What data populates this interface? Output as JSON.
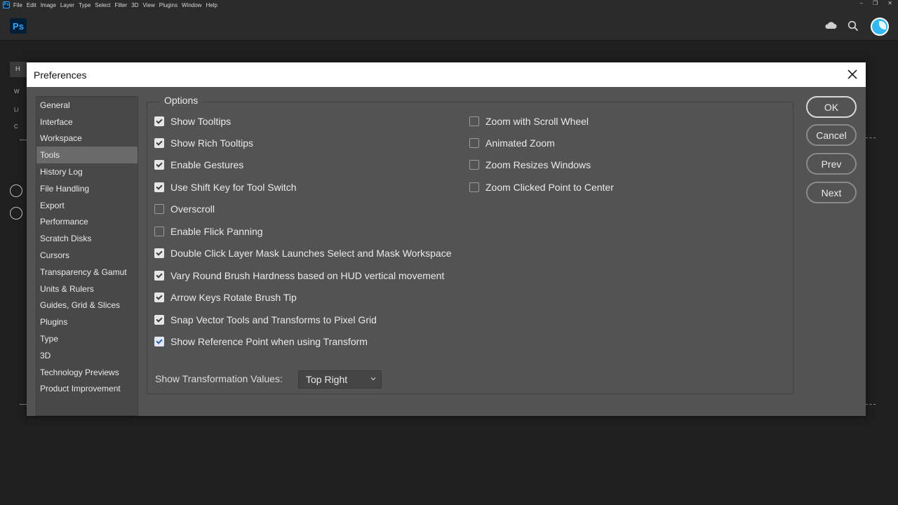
{
  "menubar": {
    "app_icon": "photoshop-icon",
    "items": [
      "File",
      "Edit",
      "Image",
      "Layer",
      "Type",
      "Select",
      "Filter",
      "3D",
      "View",
      "Plugins",
      "Window",
      "Help"
    ]
  },
  "header": {
    "logo_text": "Ps",
    "icons": [
      "cloud-icon",
      "search-icon",
      "avatar"
    ]
  },
  "background": {
    "tab_text": "H",
    "side_letters": [
      "W",
      "Li",
      "C"
    ]
  },
  "dialog": {
    "title": "Preferences",
    "sidebar": [
      {
        "label": "General",
        "active": false
      },
      {
        "label": "Interface",
        "active": false
      },
      {
        "label": "Workspace",
        "active": false
      },
      {
        "label": "Tools",
        "active": true
      },
      {
        "label": "History Log",
        "active": false
      },
      {
        "label": "File Handling",
        "active": false
      },
      {
        "label": "Export",
        "active": false
      },
      {
        "label": "Performance",
        "active": false
      },
      {
        "label": "Scratch Disks",
        "active": false
      },
      {
        "label": "Cursors",
        "active": false
      },
      {
        "label": "Transparency & Gamut",
        "active": false
      },
      {
        "label": "Units & Rulers",
        "active": false
      },
      {
        "label": "Guides, Grid & Slices",
        "active": false
      },
      {
        "label": "Plugins",
        "active": false
      },
      {
        "label": "Type",
        "active": false
      },
      {
        "label": "3D",
        "active": false
      },
      {
        "label": "Technology Previews",
        "active": false
      },
      {
        "label": "Product Improvement",
        "active": false
      }
    ],
    "options_title": "Options",
    "left_options": [
      {
        "label": "Show Tooltips",
        "checked": true
      },
      {
        "label": "Show Rich Tooltips",
        "checked": true
      },
      {
        "label": "Enable Gestures",
        "checked": true
      },
      {
        "label": "Use Shift Key for Tool Switch",
        "checked": true
      },
      {
        "label": "Overscroll",
        "checked": false
      },
      {
        "label": "Enable Flick Panning",
        "checked": false
      },
      {
        "label": "Double Click Layer Mask Launches Select and Mask Workspace",
        "checked": true
      },
      {
        "label": "Vary Round Brush Hardness based on HUD vertical movement",
        "checked": true
      },
      {
        "label": "Arrow Keys Rotate Brush Tip",
        "checked": true
      },
      {
        "label": "Snap Vector Tools and Transforms to Pixel Grid",
        "checked": true
      },
      {
        "label": "Show Reference Point when using Transform",
        "checked": true
      }
    ],
    "right_options": [
      {
        "label": "Zoom with Scroll Wheel",
        "checked": false
      },
      {
        "label": "Animated Zoom",
        "checked": false
      },
      {
        "label": "Zoom Resizes Windows",
        "checked": false
      },
      {
        "label": "Zoom Clicked Point to Center",
        "checked": false
      }
    ],
    "transformation": {
      "label": "Show Transformation Values:",
      "value": "Top Right"
    },
    "buttons": {
      "ok": "OK",
      "cancel": "Cancel",
      "prev": "Prev",
      "next": "Next"
    }
  }
}
